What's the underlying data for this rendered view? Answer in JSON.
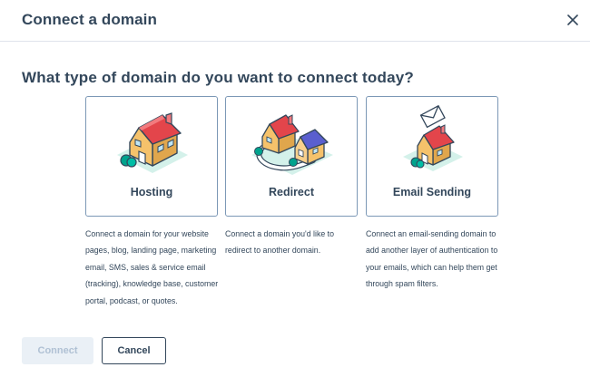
{
  "dialog": {
    "title": "Connect a domain",
    "close_icon": "close-icon"
  },
  "question": "What type of domain do you want to connect today?",
  "options": [
    {
      "label": "Hosting",
      "icon": "house-icon",
      "description": "Connect a domain for your website pages, blog, landing page, marketing email, SMS, sales & service email (tracking), knowledge base, customer portal, podcast, or quotes."
    },
    {
      "label": "Redirect",
      "icon": "two-houses-redirect-icon",
      "description": "Connect a domain you'd like to redirect to another domain."
    },
    {
      "label": "Email Sending",
      "icon": "house-with-envelope-icon",
      "description": "Connect an email-sending domain to add another layer of authentication to your emails, which can help them get through spam filters."
    }
  ],
  "footer": {
    "connect_label": "Connect",
    "cancel_label": "Cancel"
  },
  "colors": {
    "text": "#33475b",
    "border": "#7c98b6",
    "roof_red": "#e3454b",
    "roof_blue": "#5a5fcf",
    "house_wall": "#f5c26b",
    "ground": "#d4f1ea",
    "bush": "#00a38d",
    "disabled_bg": "#eaf0f6",
    "disabled_text": "#b0c1d4"
  }
}
